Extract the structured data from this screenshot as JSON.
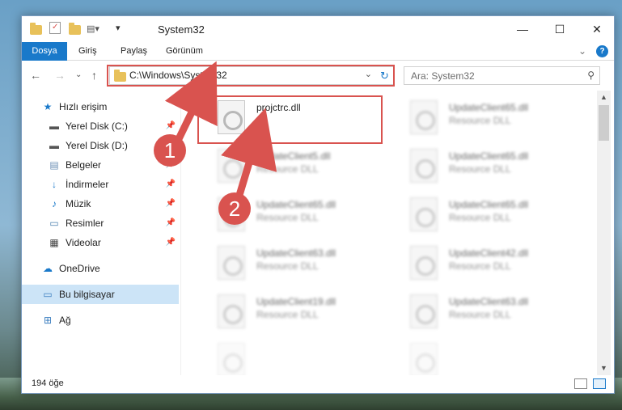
{
  "window": {
    "title": "System32",
    "minimize_glyph": "—",
    "maximize_glyph": "☐",
    "close_glyph": "✕"
  },
  "ribbon": {
    "tabs": [
      "Dosya",
      "Giriş",
      "Paylaş",
      "Görünüm"
    ],
    "help": "?",
    "collapse_glyph": "⌄"
  },
  "address_bar": {
    "path": "C:\\Windows\\System32",
    "icons": [
      "back-arrow-icon",
      "forward-arrow-icon",
      "recent-chevron-icon",
      "up-arrow-icon",
      "refresh-icon"
    ]
  },
  "search": {
    "placeholder": "Ara: System32"
  },
  "sidebar": {
    "items": [
      {
        "label": "Hızlı erişim",
        "icon": "star-icon",
        "pinned": false
      },
      {
        "label": "Yerel Disk (C:)",
        "icon": "drive-icon",
        "pinned": true
      },
      {
        "label": "Yerel Disk (D:)",
        "icon": "drive-icon",
        "pinned": true
      },
      {
        "label": "Belgeler",
        "icon": "documents-icon",
        "pinned": true
      },
      {
        "label": "İndirmeler",
        "icon": "download-icon",
        "pinned": true
      },
      {
        "label": "Müzik",
        "icon": "music-icon",
        "pinned": true
      },
      {
        "label": "Resimler",
        "icon": "pictures-icon",
        "pinned": true
      },
      {
        "label": "Videolar",
        "icon": "videos-icon",
        "pinned": true
      },
      {
        "label": "OneDrive",
        "icon": "cloud-icon",
        "pinned": false
      },
      {
        "label": "Bu bilgisayar",
        "icon": "computer-icon",
        "pinned": false,
        "selected": true
      },
      {
        "label": "Ağ",
        "icon": "network-icon",
        "pinned": false
      }
    ]
  },
  "files": [
    {
      "name": "projctrc.dll",
      "type": ""
    },
    {
      "name": "UpdateClient65.dll",
      "type": "Resource DLL"
    },
    {
      "name": "UpdateClient5.dll",
      "type": "Resource DLL"
    },
    {
      "name": "UpdateClient65.dll",
      "type": "Resource DLL"
    },
    {
      "name": "UpdateClient65.dll",
      "type": "Resource DLL"
    },
    {
      "name": "UpdateClient65.dll",
      "type": "Resource DLL"
    },
    {
      "name": "UpdateClient63.dll",
      "type": "Resource DLL"
    },
    {
      "name": "UpdateClient42.dll",
      "type": "Resource DLL"
    },
    {
      "name": "UpdateClient19.dll",
      "type": "Resource DLL"
    },
    {
      "name": "UpdateClient63.dll",
      "type": "Resource DLL"
    }
  ],
  "status": {
    "count": "194 öğe"
  },
  "annotations": {
    "step1": "1",
    "step2": "2",
    "color": "#d9534f"
  }
}
